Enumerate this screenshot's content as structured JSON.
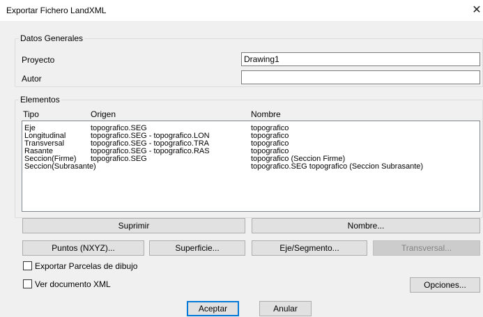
{
  "window": {
    "title": "Exportar Fichero LandXML",
    "close_glyph": "✕"
  },
  "datos_generales": {
    "legend": "Datos Generales",
    "proyecto_label": "Proyecto",
    "proyecto_value": "Drawing1",
    "autor_label": "Autor",
    "autor_value": ""
  },
  "elementos": {
    "legend": "Elementos",
    "headers": {
      "tipo": "Tipo",
      "origen": "Origen",
      "nombre": "Nombre"
    },
    "rows": [
      {
        "tipo": "Eje",
        "origen": "topografico.SEG",
        "nombre": "topografico"
      },
      {
        "tipo": "Longitudinal",
        "origen": "topografico.SEG - topografico.LON",
        "nombre": "topografico"
      },
      {
        "tipo": "Transversal",
        "origen": "topografico.SEG - topografico.TRA",
        "nombre": "topografico"
      },
      {
        "tipo": "Rasante",
        "origen": "topografico.SEG - topografico.RAS",
        "nombre": "topografico"
      },
      {
        "tipo": "Seccion(Firme)",
        "origen": "topografico.SEG",
        "nombre": "topografico (Seccion Firme)"
      },
      {
        "tipo": "Seccion(Subrasante)",
        "origen": "",
        "nombre": "topografico.SEG  topografico (Seccion Subrasante)"
      }
    ]
  },
  "buttons": {
    "suprimir": "Suprimir",
    "nombre": "Nombre...",
    "puntos": "Puntos (NXYZ)...",
    "superficie": "Superficie...",
    "eje_segmento": "Eje/Segmento...",
    "transversal": "Transversal...",
    "opciones": "Opciones...",
    "aceptar": "Aceptar",
    "anular": "Anular"
  },
  "checkboxes": {
    "exportar_parcelas": {
      "label": "Exportar Parcelas de dibujo",
      "checked": false
    },
    "ver_documento": {
      "label": "Ver documento XML",
      "checked": false
    }
  }
}
